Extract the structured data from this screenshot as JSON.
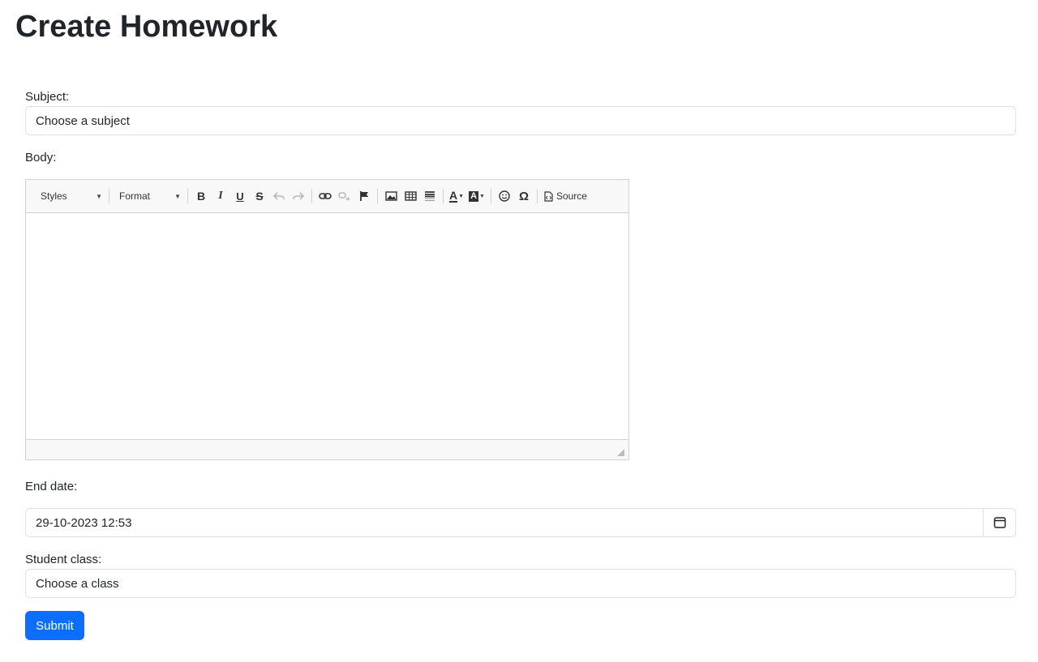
{
  "page": {
    "title": "Create Homework"
  },
  "form": {
    "subject": {
      "label": "Subject:",
      "value": "Choose a subject"
    },
    "body": {
      "label": "Body:"
    },
    "end_date": {
      "label": "End date:",
      "value": "29-10-2023 12:53",
      "calendar_icon": "calendar-icon"
    },
    "student_class": {
      "label": "Student class:",
      "value": "Choose a class"
    },
    "submit_label": "Submit"
  },
  "editor": {
    "styles_label": "Styles",
    "format_label": "Format",
    "bold_glyph": "B",
    "italic_glyph": "I",
    "underline_glyph": "U",
    "strike_glyph": "S",
    "text_color_glyph": "A",
    "bg_color_glyph": "A",
    "special_char_glyph": "Ω",
    "source_label": "Source",
    "icons": [
      "bold-icon",
      "italic-icon",
      "underline-icon",
      "strikethrough-icon",
      "undo-icon",
      "redo-icon",
      "link-icon",
      "unlink-icon",
      "anchor-icon",
      "image-icon",
      "table-icon",
      "horizontal-line-icon",
      "text-color-icon",
      "background-color-icon",
      "smiley-icon",
      "special-character-icon",
      "source-icon"
    ]
  },
  "colors": {
    "primary": "#0d6efd",
    "text": "#212529",
    "border": "#dee2e6",
    "toolbar_bg": "#f8f8f8"
  }
}
